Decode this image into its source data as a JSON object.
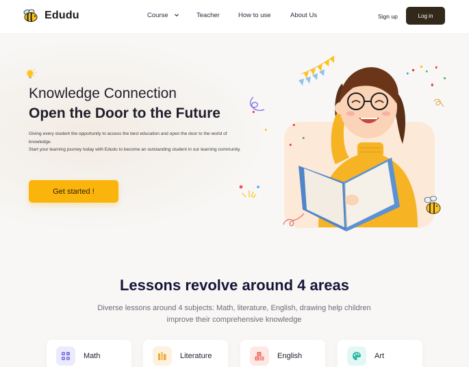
{
  "brand": {
    "name": "Edudu",
    "logo_icon": "bee-icon"
  },
  "nav": {
    "items": [
      {
        "label": "Course",
        "has_dropdown": true
      },
      {
        "label": "Teacher"
      },
      {
        "label": "How to use"
      },
      {
        "label": "About Us"
      }
    ]
  },
  "auth": {
    "signup_label": "Sign up",
    "login_label": "Log in"
  },
  "hero": {
    "title_line1": "Knowledge Connection",
    "title_line2": "Open the Door to the Future",
    "description_1": "Giving every student the opportunity to access the best education and open the door to the world of knowledge.",
    "description_2": "Start your learning journey today with Edudu to become an outstanding student in our learning community.",
    "cta_label": "Get started !"
  },
  "lessons": {
    "title": "Lessons revolve around 4 areas",
    "subtitle": "Diverse lessons around 4 subjects: Math, literature, English, drawing help children improve their comprehensive knowledge",
    "cards": [
      {
        "label": "Math",
        "icon": "calculator-icon",
        "bg": "#eceafd",
        "fg": "#7b74e8"
      },
      {
        "label": "Literature",
        "icon": "books-icon",
        "bg": "#fdf1df",
        "fg": "#f2a93b"
      },
      {
        "label": "English",
        "icon": "abc-blocks-icon",
        "bg": "#fde8e6",
        "fg": "#ee6c5e"
      },
      {
        "label": "Art",
        "icon": "palette-icon",
        "bg": "#e3f7f5",
        "fg": "#2fb8a8"
      }
    ]
  },
  "colors": {
    "accent": "#fbb40c",
    "dark_button": "#33291b",
    "title": "#15163a"
  }
}
